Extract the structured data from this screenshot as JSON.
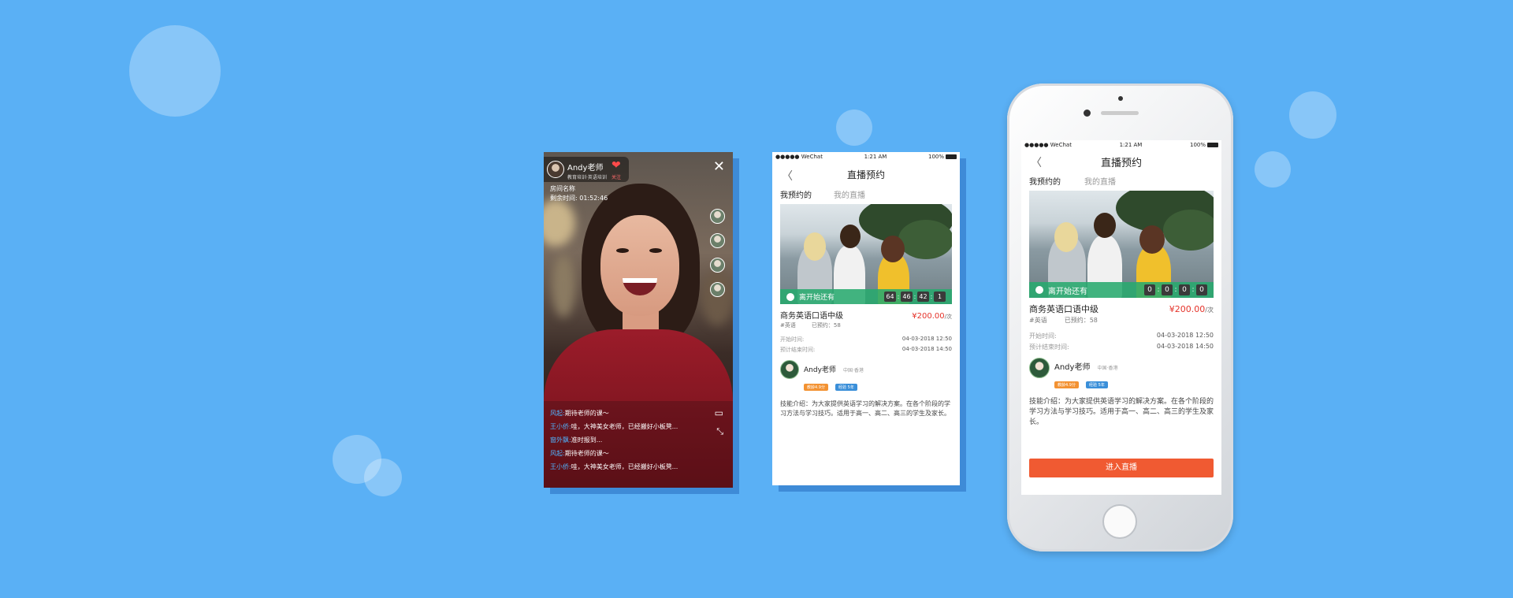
{
  "live": {
    "host_name": "Andy老师",
    "host_sub": "教育培训·英语培训",
    "follow_label": "关注",
    "room_name": "房间名称",
    "remaining_label": "剩余时间:",
    "remaining_value": "01:52:46",
    "chat": [
      {
        "user": "风起:",
        "text": "期待老师的课～"
      },
      {
        "user": "王小侨:",
        "text": "哇，大神美女老师，已经搬好小板凳..."
      },
      {
        "user": "窗外飘:",
        "text": "准时报到..."
      },
      {
        "user": "风起:",
        "text": "期待老师的课～"
      },
      {
        "user": "王小侨:",
        "text": "哇，大神美女老师，已经搬好小板凳..."
      }
    ],
    "icons": {
      "close": "close-icon",
      "chat": "chat-bubble-icon",
      "shrink": "shrink-icon",
      "heart": "heart-icon"
    }
  },
  "booking_flat": {
    "status_carrier": "●●●●● WeChat",
    "status_time": "1:21 AM",
    "status_battery": "100%",
    "title": "直播预约",
    "tab_active": "我预约的",
    "tab_inactive": "我的直播",
    "countdown_label": "离开始还有",
    "countdown": [
      "64",
      "46",
      "42",
      "1"
    ],
    "course": "商务英语口语中级",
    "price": "¥200.00",
    "price_unit": "/次",
    "tag": "#英语",
    "booked": "已预约：58",
    "start_label": "开始时间:",
    "start_value": "04-03-2018 12:50",
    "end_label": "预计结束时间:",
    "end_value": "04-03-2018 14:50",
    "teacher": "Andy老师",
    "location": "中国·香港",
    "badge1": "教龄4.9分",
    "badge2": "经验 5年",
    "intro": "技能介绍：为大家提供英语学习的解决方案。在各个阶段的学习方法与学习技巧。适用于高一、高二、高三的学生及家长。"
  },
  "booking_phone": {
    "status_carrier": "●●●●● WeChat",
    "status_time": "1:21 AM",
    "status_battery": "100%",
    "title": "直播预约",
    "tab_active": "我预约的",
    "tab_inactive": "我的直播",
    "countdown_label": "离开始还有",
    "countdown": [
      "0",
      "0",
      "0",
      "0"
    ],
    "course": "商务英语口语中级",
    "price": "¥200.00",
    "price_unit": "/次",
    "tag": "#英语",
    "booked": "已预约：58",
    "start_label": "开始时间:",
    "start_value": "04-03-2018 12:50",
    "end_label": "预计结束时间:",
    "end_value": "04-03-2018 14:50",
    "teacher": "Andy老师",
    "location": "中国·香港",
    "badge1": "教龄4.9分",
    "badge2": "经验 5年",
    "intro": "技能介绍：为大家提供英语学习的解决方案。在各个阶段的学习方法与学习技巧。适用于高一、高二、高三的学生及家长。",
    "enter_button": "进入直播"
  },
  "colors": {
    "background": "#5ab0f5",
    "accent_green": "#28aa6e",
    "price_red": "#e5332a",
    "enter_orange": "#f05a32"
  }
}
